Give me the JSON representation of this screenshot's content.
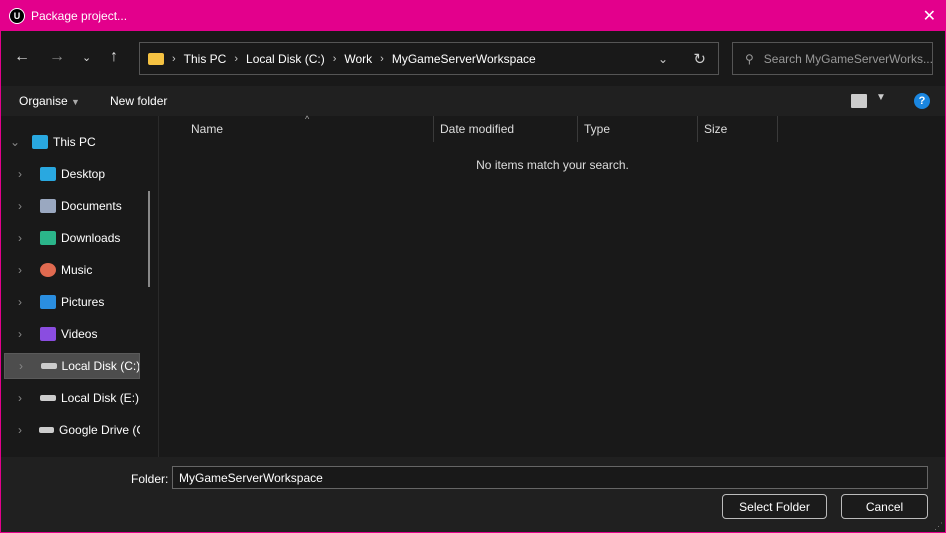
{
  "window": {
    "title": "Package project...",
    "accent": "#e3008c"
  },
  "address": {
    "crumbs": [
      "This PC",
      "Local Disk (C:)",
      "Work",
      "MyGameServerWorkspace"
    ]
  },
  "search": {
    "placeholder": "Search MyGameServerWorks..."
  },
  "toolbar": {
    "organise": "Organise",
    "new_folder": "New folder",
    "help": "?"
  },
  "sidebar": {
    "items": [
      {
        "label": "This PC",
        "icon": "computer-icon",
        "color": "#29a8e0"
      },
      {
        "label": "Desktop",
        "icon": "desktop-icon",
        "color": "#29a8e0"
      },
      {
        "label": "Documents",
        "icon": "documents-icon",
        "color": "#9aa8c0"
      },
      {
        "label": "Downloads",
        "icon": "download-icon",
        "color": "#2bb58a"
      },
      {
        "label": "Music",
        "icon": "music-icon",
        "color": "#e06a50"
      },
      {
        "label": "Pictures",
        "icon": "pictures-icon",
        "color": "#2a8ee0"
      },
      {
        "label": "Videos",
        "icon": "videos-icon",
        "color": "#8a4de0"
      },
      {
        "label": "Local Disk (C:)",
        "icon": "drive-icon",
        "color": "#cccccc"
      },
      {
        "label": "Local Disk (E:)",
        "icon": "drive-icon",
        "color": "#cccccc"
      },
      {
        "label": "Google Drive (G",
        "icon": "drive-icon",
        "color": "#cccccc"
      }
    ]
  },
  "columns": [
    "Name",
    "Date modified",
    "Type",
    "Size"
  ],
  "empty_message": "No items match your search.",
  "footer": {
    "folder_label": "Folder:",
    "folder_value": "MyGameServerWorkspace",
    "select": "Select Folder",
    "cancel": "Cancel"
  }
}
